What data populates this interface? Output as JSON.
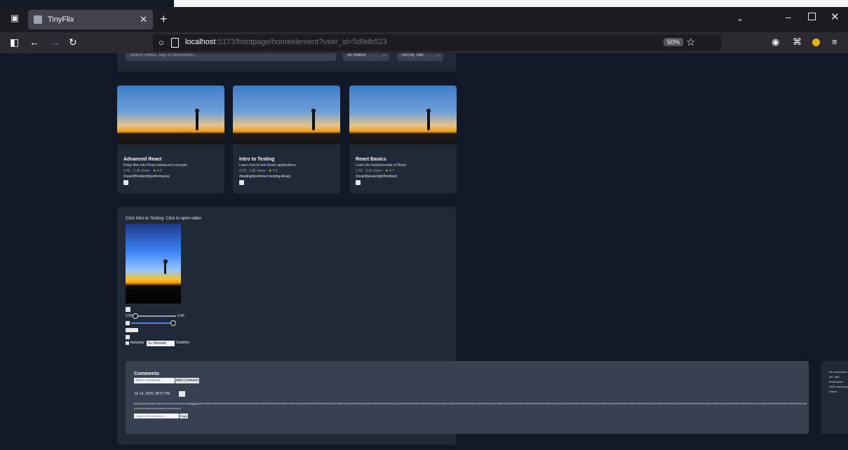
{
  "browser": {
    "tab_title": "TinyFlix",
    "url_host": "localhost",
    "url_rest": ":5173/frontpage/homeelement?user_id=5d9db523",
    "zoom": "50%"
  },
  "filters": {
    "search_placeholder": "Search videos, tags or description...",
    "select_filter": "All Videos",
    "select_sort": "Sort by Title"
  },
  "videos": [
    {
      "title": "Advanced React",
      "desc": "Deep dive into React advanced concepts",
      "meta_a": "2:45 · 2.3k views ·",
      "meta_star": "★",
      "meta_b": "4.6",
      "tags": "#react#frontend#performance"
    },
    {
      "title": "Intro to Testing",
      "desc": "Learn how to test React applications",
      "meta_a": "2:15 · 1.8k views ·",
      "meta_star": "★",
      "meta_b": "4.3",
      "tags": "#testing#jest#react-testing-library"
    },
    {
      "title": "React Basics",
      "desc": "Learn the fundamentals of React",
      "meta_a": "1:50 · 3.1k views ·",
      "meta_star": "★",
      "meta_b": "4.7",
      "tags": "#react#javascript#frontend"
    }
  ],
  "player": {
    "now_playing": "Click Intro to Testing: Click to open video",
    "time_start": "0:00",
    "time_end": "0:45",
    "mute_label": "Mute",
    "autoplay_label": "Autoplay",
    "speed_value": "1x (Normal)",
    "subtitles_label": "Subtitles"
  },
  "comments": {
    "heading": "Comments",
    "input_placeholder": "Add a comment...",
    "submit_label": "Add Comment",
    "meta": "Jul 14, 2025, 08:07 PM",
    "text": "kjjknjnjknjknjknjknknknknknknknknknknknknjkjjjjggjkkhhhhhhhhhhhhhhhhhhhhhhhhhhhhhhhhhhhhhhhhhhhhhhhhhhhhhhhhhhhhhhhhhhhhhhhhhhhhhhhhhhhhhhhhhhhhhhhhhhhhhhhhhhhhhhhhhhhhhhhhhhhhhhhhhhhhhhhhhhhhhhhhhhhhhhhhhhhhhhhhhhhhhhhhhhhhhhhhhhhhhhhhhhhhhhhhhhhhhhhhhhhhhhhhhhhhhhhhhhhhhhhhhhhhhhhhhhhhhhhhhhhhhhhhhhhhhhhhhhhhhhhhhhhhhhhhhhhhhhhhhhhhhhhhhhhhhhhhhhhhhhhhhhhhhhhhhhhhhhhhhhhhhhhhhhhhhhhhhhhhhhhhhhhhhhhhhhhhhhhhhhhhhhhhhhhhhhhhhhhhhhhhhhhhhhhhhhhhhhhhhhhhhhhhhhhhhhhhhhh",
    "reply_placeholder": "Reply to this comment...",
    "reply_label": "Reply"
  },
  "side_panel": {
    "text": "No bookmarks yet. Add bookmarks while watching videos"
  }
}
